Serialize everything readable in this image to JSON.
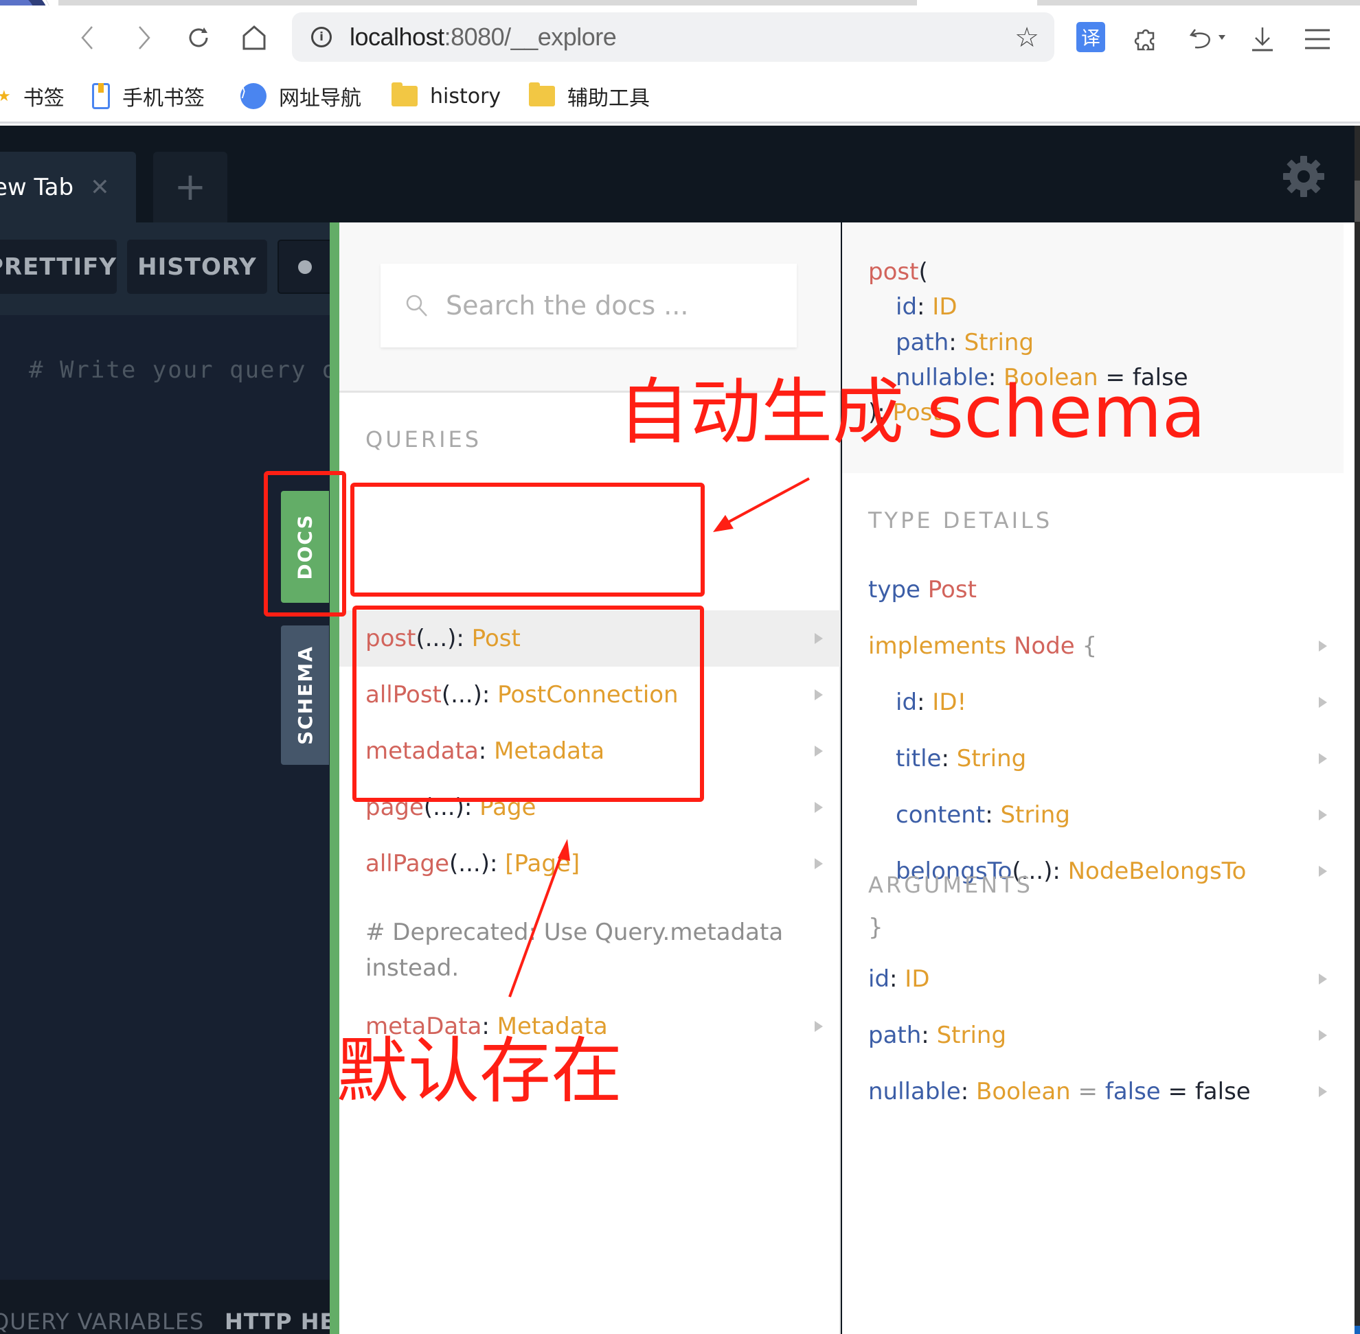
{
  "browser": {
    "url_host": "localhost",
    "url_path": ":8080/__explore",
    "nav": {
      "back_icon": "chevron-left",
      "forward_icon": "chevron-right",
      "reload_icon": "reload",
      "home_icon": "home"
    },
    "extensions": {
      "translate_label": "译"
    },
    "bookmarks": [
      {
        "label": "书签",
        "icon": "star-icon"
      },
      {
        "label": "手机书签",
        "icon": "phone-bookmark-icon"
      },
      {
        "label": "网址导航",
        "icon": "nav-icon"
      },
      {
        "label": "history",
        "icon": "folder-icon"
      },
      {
        "label": "辅助工具",
        "icon": "folder-icon"
      }
    ]
  },
  "playground": {
    "tabs": [
      {
        "label": "ew Tab",
        "close": "✕"
      }
    ],
    "add_tab": "+",
    "toolbar": {
      "prettify": "PRETTIFY",
      "history": "HISTORY"
    },
    "editor_placeholder": "# Write your query or",
    "bottom": {
      "query_variables": "QUERY VARIABLES",
      "http_headers": "HTTP HEADERS"
    },
    "side_tabs": {
      "docs": "DOCS",
      "schema": "SCHEMA"
    }
  },
  "docs": {
    "search_placeholder": "Search the docs ...",
    "queries_title": "QUERIES",
    "queries": [
      {
        "name": "post",
        "args": "(...)",
        "sep": ": ",
        "type": "Post",
        "active": true
      },
      {
        "name": "allPost",
        "args": "(...)",
        "sep": ": ",
        "type": "PostConnection"
      },
      {
        "name": "metadata",
        "args": "",
        "sep": ": ",
        "type": "Metadata"
      },
      {
        "name": "page",
        "args": "(...)",
        "sep": ": ",
        "type": "Page"
      },
      {
        "name": "allPage",
        "args": "(...)",
        "sep": ": ",
        "type": "[Page]"
      }
    ],
    "deprecated_note": "# Deprecated: Use Query.metadata instead.",
    "deprecated_field": {
      "name": "metaData",
      "sep": ": ",
      "type": "Metadata"
    }
  },
  "type_panel": {
    "signature": {
      "name": "post",
      "open": "(",
      "args": [
        {
          "name": "id",
          "sep": ": ",
          "type": "ID",
          "default": ""
        },
        {
          "name": "path",
          "sep": ": ",
          "type": "String",
          "default": ""
        },
        {
          "name": "nullable",
          "sep": ": ",
          "type": "Boolean",
          "default": " = false"
        }
      ],
      "close": "): ",
      "return_type": "Post"
    },
    "type_details_title": "TYPE DETAILS",
    "type_kw": "type ",
    "type_name": "Post",
    "implements_kw": "implements ",
    "interface": "Node",
    "brace_open": " {",
    "brace_close": "}",
    "fields": [
      {
        "name": "id",
        "args": "",
        "sep": ": ",
        "type": "ID!"
      },
      {
        "name": "title",
        "args": "",
        "sep": ": ",
        "type": "String"
      },
      {
        "name": "content",
        "args": "",
        "sep": ": ",
        "type": "String"
      },
      {
        "name": "belongsTo",
        "args": "(...)",
        "sep": ": ",
        "type": "NodeBelongsTo"
      }
    ],
    "arguments_title": "ARGUMENTS",
    "arguments": [
      {
        "name": "id",
        "sep": ": ",
        "type": "ID",
        "eq": "",
        "def": "",
        "extra": ""
      },
      {
        "name": "path",
        "sep": ": ",
        "type": "String",
        "eq": "",
        "def": "",
        "extra": ""
      },
      {
        "name": "nullable",
        "sep": ": ",
        "type": "Boolean",
        "eq": " = ",
        "def": "false",
        "extra": " = false"
      }
    ]
  },
  "annotations": {
    "auto_schema": "自动生成 schema",
    "default_exists": "默认存在",
    "color": "#ff1f14"
  }
}
